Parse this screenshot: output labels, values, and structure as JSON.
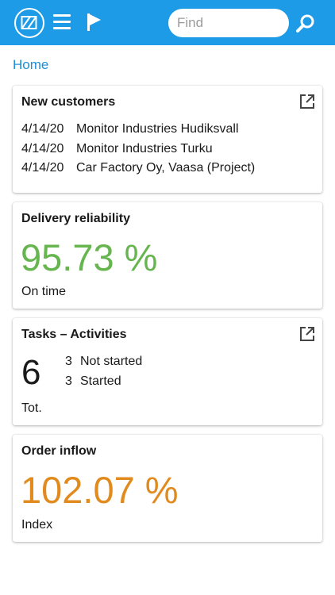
{
  "header": {
    "search": {
      "placeholder": "Find"
    },
    "icons": {
      "logo": "app-logo",
      "menu": "hamburger-menu-icon",
      "flag": "flag-icon",
      "search": "search-icon"
    },
    "accent_color": "#1e9be7"
  },
  "breadcrumb": {
    "home": "Home"
  },
  "cards": {
    "new_customers": {
      "title": "New customers",
      "rows": [
        {
          "date": "4/14/20",
          "name": "Monitor Industries Hudiksvall"
        },
        {
          "date": "4/14/20",
          "name": "Monitor Industries Turku"
        },
        {
          "date": "4/14/20",
          "name": "Car Factory Oy, Vaasa (Project)"
        }
      ]
    },
    "delivery": {
      "title": "Delivery reliability",
      "value": "95.73 %",
      "caption": "On time",
      "value_color": "#66b54e"
    },
    "tasks": {
      "title": "Tasks – Activities",
      "total": "6",
      "rows": [
        {
          "count": "3",
          "label": "Not started"
        },
        {
          "count": "3",
          "label": "Started"
        }
      ],
      "caption": "Tot."
    },
    "order_inflow": {
      "title": "Order inflow",
      "value": "102.07 %",
      "caption": "Index",
      "value_color": "#e18a1e"
    }
  }
}
